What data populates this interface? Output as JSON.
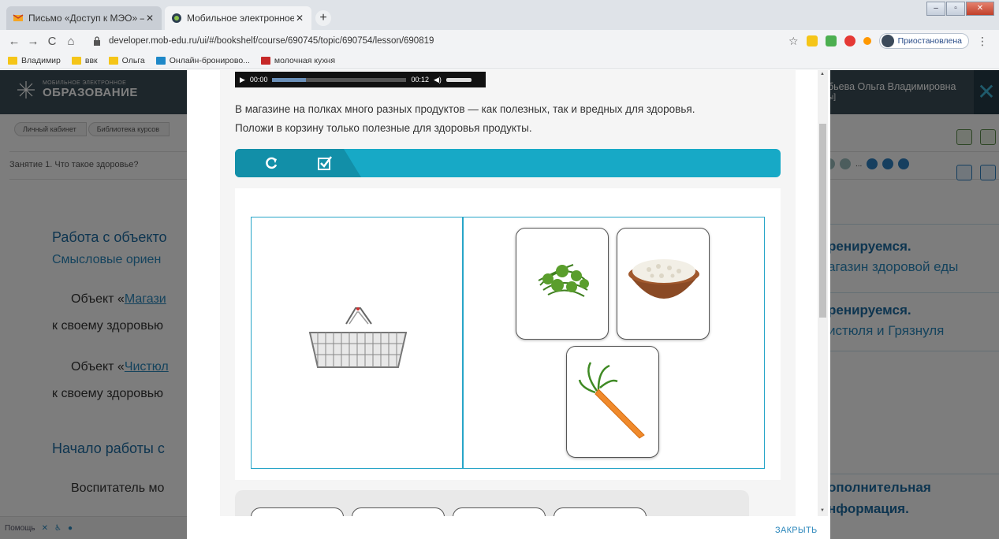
{
  "browser": {
    "tabs": [
      {
        "title": "Письмо «Доступ к МЭО» — Род",
        "active": false
      },
      {
        "title": "Мобильное электронное обра",
        "active": true
      }
    ],
    "new_tab_glyph": "+",
    "url": "developer.mob-edu.ru/ui/#/bookshelf/course/690745/topic/690754/lesson/690819",
    "profile_status": "Приостановлена",
    "bookmarks": [
      "Владимир",
      "ввк",
      "Ольга",
      "Онлайн-бронирово...",
      "молочная кухня"
    ]
  },
  "site": {
    "logo_small": "МОБИЛЬНОЕ ЭЛЕКТРОННОЕ",
    "logo_big": "ОБРАЗОВАНИЕ",
    "user_name": "бьева Ольга Владимировна",
    "user_sub": "ы]",
    "breadcrumbs": [
      "Личный кабинет",
      "Библиотека курсов"
    ],
    "lesson_title": "Занятие 1. Что такое здоровье?",
    "page_number_hint": "...",
    "left": {
      "heading1": "Работа с объекто",
      "sub1": "Смысловые ориен",
      "p1_prefix": "Объект «",
      "p1_link": "Магази",
      "p1_line2": "к своему здоровью",
      "p2_prefix": "Объект «",
      "p2_link": "Чистюл",
      "p2_line2": "к своему здоровью",
      "heading2": "Начало работы с",
      "p3": "Воспитатель мо"
    },
    "right": {
      "h1": "ренируемся.",
      "s1": "агазин здоровой еды",
      "h2": "ренируемся.",
      "s2": "истюля и Грязнуля",
      "h3": "ополнительная",
      "h3b": "нформация."
    },
    "status_help": "Помощь"
  },
  "modal": {
    "audio": {
      "time_current": "00:00",
      "time_total": "00:12",
      "progress": 0.25
    },
    "instruction_line1": "В магазине на полках много разных продуктов — как полезных, так и вредных для здоровья.",
    "instruction_line2": "Положи в корзину только полезные для здоровья продукты.",
    "tools": [
      {
        "icon": "refresh-icon"
      },
      {
        "icon": "check-icon"
      }
    ],
    "cards": [
      {
        "icon": "dill-icon"
      },
      {
        "icon": "cottage-cheese-icon"
      },
      {
        "icon": "carrot-icon"
      }
    ],
    "close_label": "ЗАКРЫТЬ"
  },
  "colors": {
    "accent": "#17a9c6",
    "header": "#3a4d56",
    "link": "#2a86bb"
  }
}
